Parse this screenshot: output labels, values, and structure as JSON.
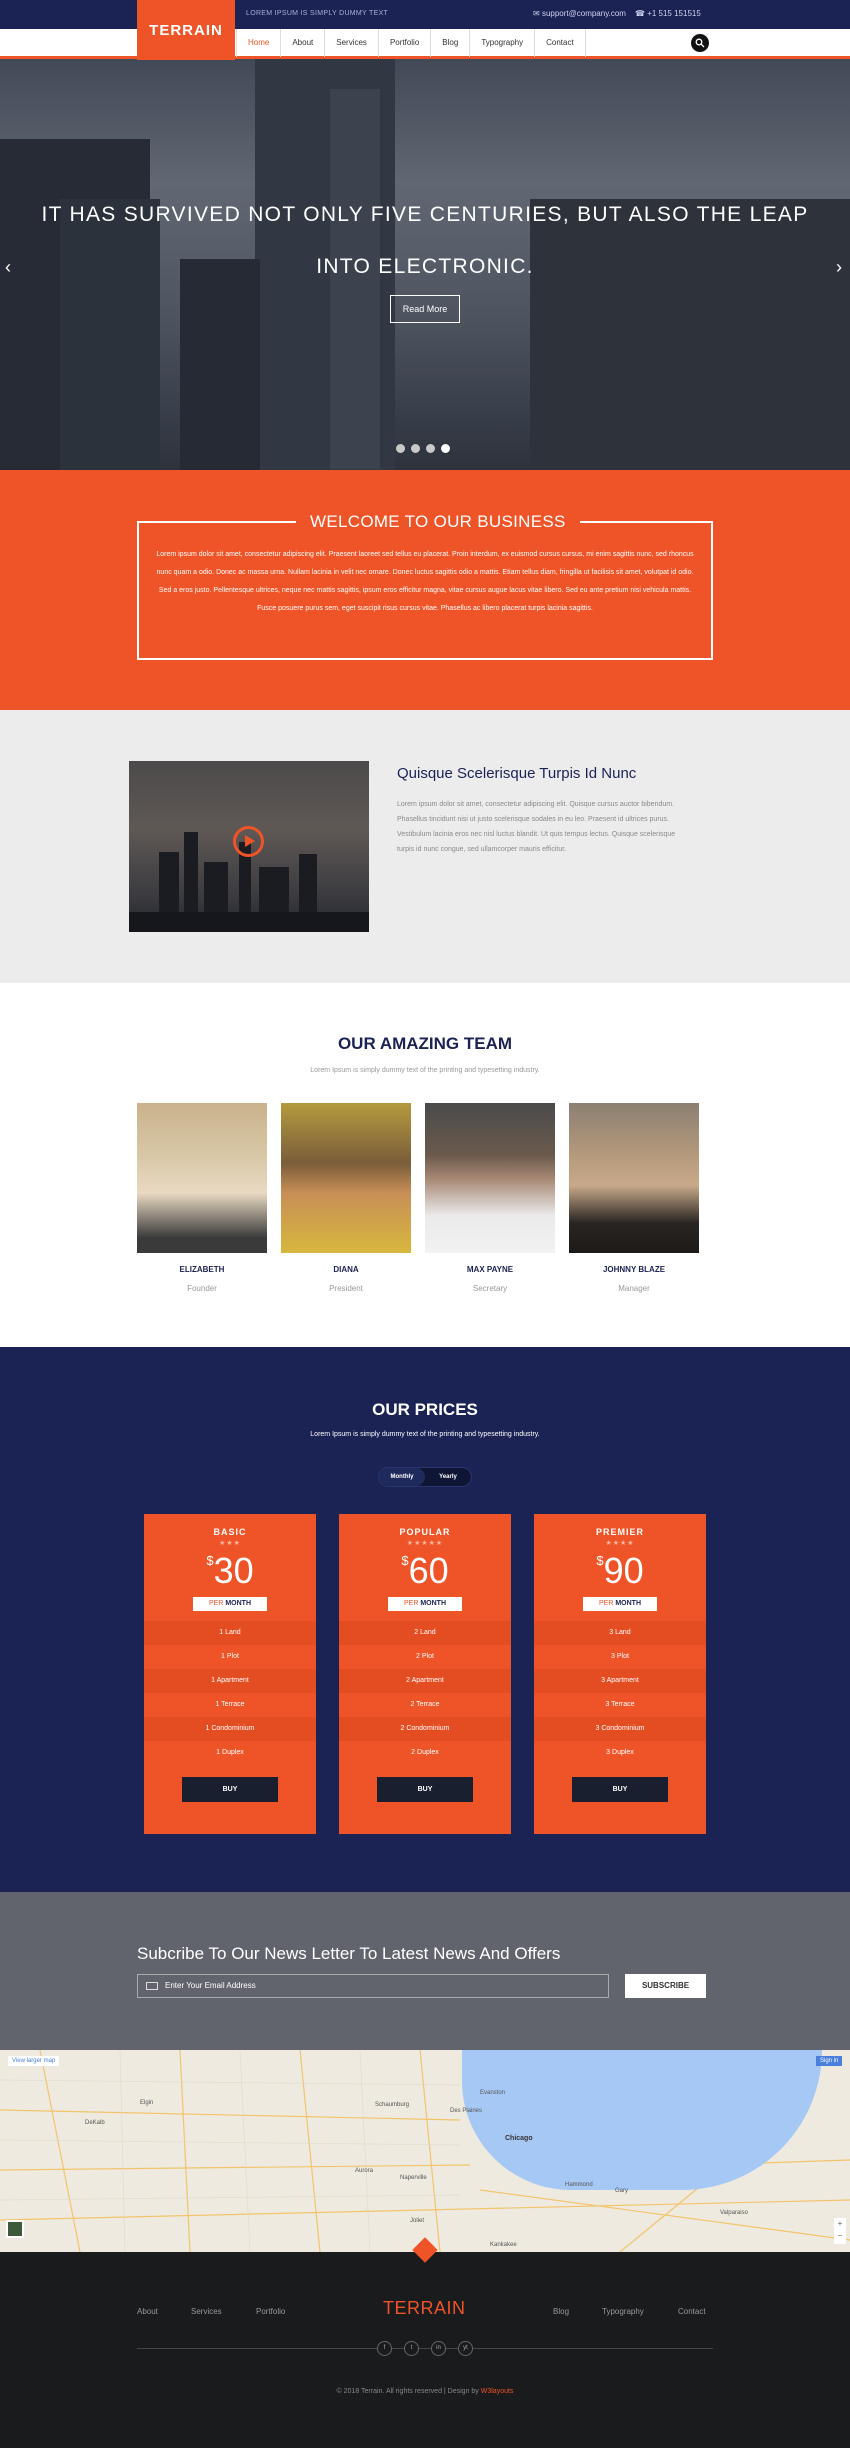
{
  "brand": {
    "logo": "TERRAIN",
    "tagline": "LOREM IPSUM IS SIMPLY DUMMY TEXT",
    "email": "support@company.com",
    "phone": "+1 515 151515"
  },
  "nav": {
    "items": [
      "Home",
      "About",
      "Services",
      "Portfolio",
      "Blog",
      "Typography",
      "Contact"
    ],
    "active": "Home"
  },
  "hero": {
    "headline": "IT HAS SURVIVED NOT ONLY FIVE CENTURIES, BUT ALSO THE LEAP INTO ELECTRONIC.",
    "button": "Read More",
    "slide_count": 4,
    "active_slide": 4
  },
  "welcome": {
    "title": "WELCOME TO OUR BUSINESS",
    "text": "Lorem ipsum dolor sit amet, consectetur adipiscing elit. Praesent laoreet sed tellus eu placerat. Proin interdum, ex euismod cursus cursus, mi enim sagittis nunc, sed rhoncus nunc quam a odio. Donec ac massa urna. Nullam lacinia in velit nec ornare. Donec luctus sagittis odio a mattis. Etiam tellus diam, fringilla ut facilisis sit amet, volutpat id odio. Sed a eros justo. Pellentesque ultrices, neque nec mattis sagittis, ipsum eros efficitur magna, vitae cursus augue lacus vitae libero. Sed eu ante pretium nisi vehicula mattis. Fusce posuere purus sem, eget suscipit risus cursus vitae. Phasellus ac libero placerat turpis lacinia sagittis."
  },
  "about": {
    "title": "Quisque Scelerisque Turpis Id Nunc",
    "text": "Lorem ipsum dolor sit amet, consectetur adipiscing elit. Quisque cursus auctor bibendum. Phasellus tincidunt nisi ut justo scelerisque sodales in eu leo. Praesent id ultrices purus. Vestibulum lacinia eros nec nisl luctus blandit. Ut quis tempus lectus. Quisque scelerisque turpis id nunc congue, sed ullamcorper mauris efficitur."
  },
  "team": {
    "title": "OUR AMAZING TEAM",
    "subtitle": "Lorem Ipsum is simply dummy text of the printing and typesetting industry.",
    "members": [
      {
        "name": "ELIZABETH",
        "role": "Founder"
      },
      {
        "name": "DIANA",
        "role": "President"
      },
      {
        "name": "MAX PAYNE",
        "role": "Secretary"
      },
      {
        "name": "JOHNNY BLAZE",
        "role": "Manager"
      }
    ]
  },
  "prices": {
    "title": "OUR PRICES",
    "subtitle": "Lorem Ipsum is simply dummy text of the printing and typesetting industry.",
    "toggle": [
      "Monthly",
      "Yearly"
    ],
    "toggle_active": "Monthly",
    "per_prefix": "PER",
    "per_unit": "MONTH",
    "currency": "$",
    "buy": "BUY",
    "plans": [
      {
        "name": "BASIC",
        "stars": "★★★",
        "price": "30",
        "features": [
          "1 Land",
          "1 Plot",
          "1 Apartment",
          "1 Terrace",
          "1 Condominium",
          "1 Duplex"
        ]
      },
      {
        "name": "POPULAR",
        "stars": "★★★★★",
        "price": "60",
        "features": [
          "2 Land",
          "2 Plot",
          "2 Apartment",
          "2 Terrace",
          "2 Condominium",
          "2 Duplex"
        ]
      },
      {
        "name": "PREMIER",
        "stars": "★★★★",
        "price": "90",
        "features": [
          "3 Land",
          "3 Plot",
          "3 Apartment",
          "3 Terrace",
          "3 Condominium",
          "3 Duplex"
        ]
      }
    ]
  },
  "newsletter": {
    "title": "Subcribe To Our News Letter To Latest News And Offers",
    "placeholder": "Enter Your Email Address",
    "button": "SUBSCRIBE"
  },
  "map": {
    "larger_link": "View larger map",
    "sign_in": "Sign in",
    "cities": [
      "Elgin",
      "Schaumburg",
      "Des Plaines",
      "Evanston",
      "Chicago",
      "Aurora",
      "Naperville",
      "Joliet",
      "Gary",
      "Hammond",
      "DeKalb",
      "Kankakee",
      "Valparaiso"
    ]
  },
  "footer": {
    "left_links": [
      "About",
      "Services",
      "Portfolio"
    ],
    "logo": "TERRAIN",
    "right_links": [
      "Blog",
      "Typography",
      "Contact"
    ],
    "social": [
      "f",
      "t",
      "in",
      "yt"
    ],
    "copyright": "© 2018 Terrain. All rights reserved | Design by",
    "designer": "W3layouts"
  },
  "colors": {
    "accent": "#ef5428",
    "navy": "#1b2254",
    "dark": "#1a1b1d"
  }
}
